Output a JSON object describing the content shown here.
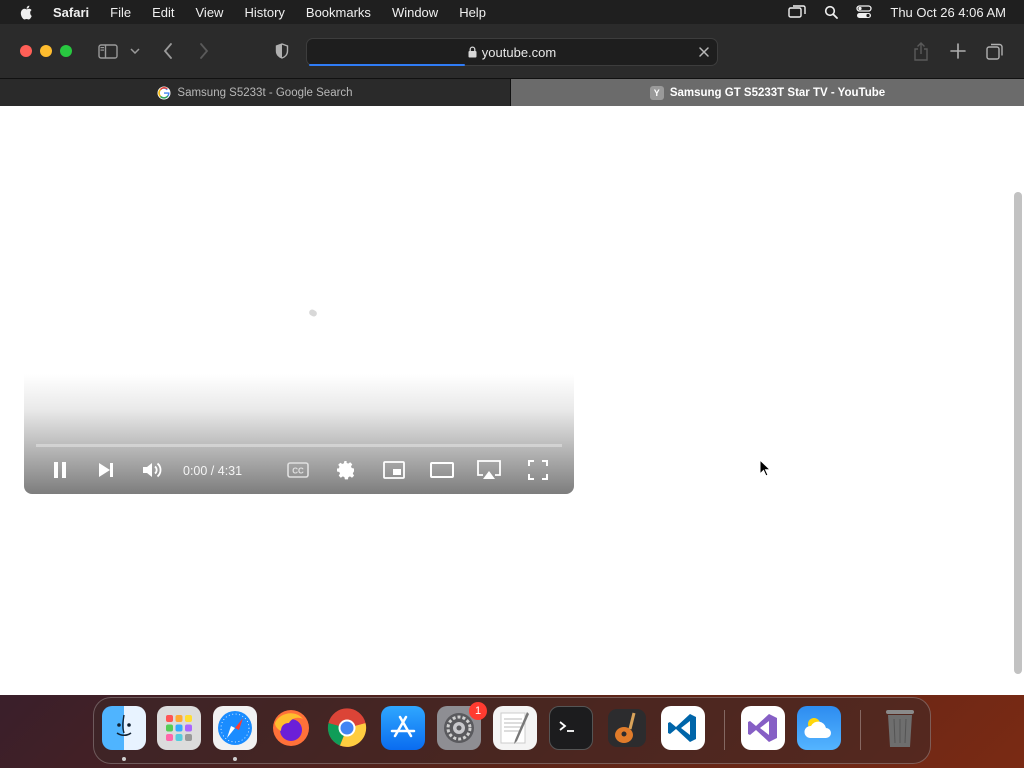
{
  "menubar": {
    "app_name": "Safari",
    "items": [
      "File",
      "Edit",
      "View",
      "History",
      "Bookmarks",
      "Window",
      "Help"
    ],
    "clock": "Thu Oct 26  4:06 AM"
  },
  "toolbar": {
    "url": "youtube.com",
    "load_progress": 0.38
  },
  "tabs": [
    {
      "title": "Samsung S5233t - Google Search",
      "favicon": "google-icon",
      "active": false
    },
    {
      "title": "Samsung GT S5233T Star TV - YouTube",
      "favicon_letter": "Y",
      "active": true
    }
  ],
  "player": {
    "time": "0:00 / 4:31",
    "controls": [
      "pause-icon",
      "next-icon",
      "volume-icon",
      "captions-icon",
      "settings-icon",
      "miniplayer-icon",
      "theater-icon",
      "airplay-icon",
      "fullscreen-icon"
    ]
  },
  "dock": {
    "apps": [
      "finder",
      "launchpad",
      "safari",
      "firefox",
      "chrome",
      "app-store",
      "system-settings",
      "textedit",
      "terminal",
      "garageband",
      "vscode",
      "visual-studio",
      "weather",
      "trash"
    ],
    "system_settings_badge": "1",
    "colors": {
      "safari": "#1a8cff",
      "vscode": "#0065a9",
      "firefox": "#ff7139"
    }
  }
}
